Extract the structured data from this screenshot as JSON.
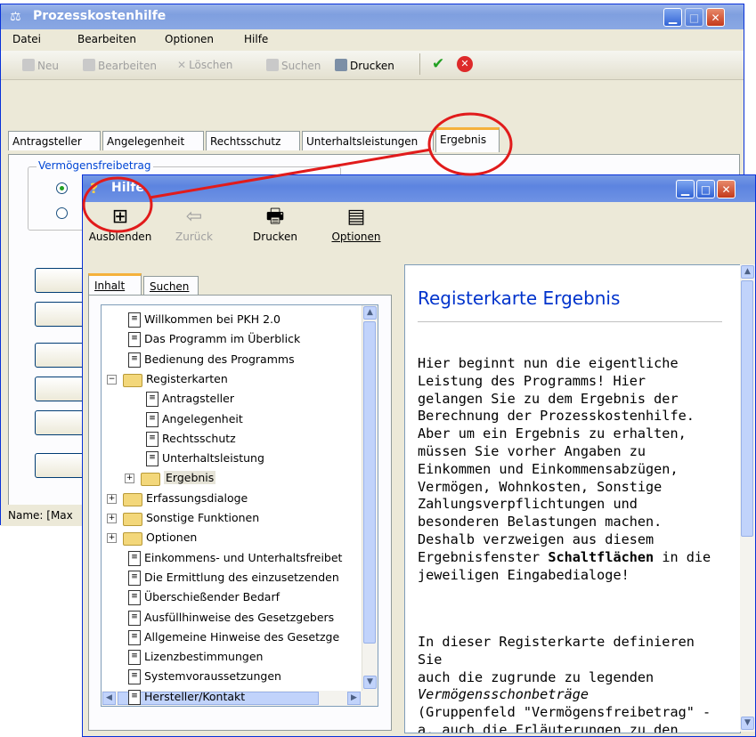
{
  "main_window": {
    "title": "Prozesskostenhilfe",
    "menu": [
      "Datei",
      "Bearbeiten",
      "Optionen",
      "Hilfe"
    ],
    "toolbar": {
      "new_label": "Neu",
      "edit_label": "Bearbeiten",
      "delete_label": "Löschen",
      "search_label": "Suchen",
      "print_label": "Drucken"
    },
    "tabs": [
      "Antragsteller",
      "Angelegenheit",
      "Rechtsschutz",
      "Unterhaltsleistungen",
      "Ergebnis"
    ],
    "group_label": "Vermögensfreibetrag",
    "status_text": "Name: [Max"
  },
  "help_window": {
    "title": "Hilfe",
    "toolbar": {
      "hide_label": "Ausblenden",
      "back_label": "Zurück",
      "print_label": "Drucken",
      "options_label": "Optionen"
    },
    "nav_tabs": [
      "Inhalt",
      "Suchen"
    ],
    "tree": [
      {
        "label": "Willkommen bei PKH 2.0",
        "icon": "page-icon",
        "level": 1
      },
      {
        "label": "Das Programm im Überblick",
        "icon": "page-icon",
        "level": 1
      },
      {
        "label": "Bedienung des Programms",
        "icon": "page-icon",
        "level": 1
      },
      {
        "label": "Registerkarten",
        "icon": "open-folder-icon",
        "level": 0,
        "expanded": true
      },
      {
        "label": "Antragsteller",
        "icon": "page-icon",
        "level": 2
      },
      {
        "label": "Angelegenheit",
        "icon": "page-icon",
        "level": 2
      },
      {
        "label": "Rechtsschutz",
        "icon": "page-icon",
        "level": 2
      },
      {
        "label": "Unterhaltsleistung",
        "icon": "page-icon",
        "level": 2
      },
      {
        "label": "Ergebnis",
        "icon": "folder-icon",
        "level": 1,
        "collapsed": true
      },
      {
        "label": "Erfassungsdialoge",
        "icon": "folder-icon",
        "level": 0,
        "collapsed": true
      },
      {
        "label": "Sonstige Funktionen",
        "icon": "folder-icon",
        "level": 0,
        "collapsed": true
      },
      {
        "label": "Optionen",
        "icon": "folder-icon",
        "level": 0,
        "collapsed": true
      },
      {
        "label": "Einkommens- und Unterhaltsfreibet",
        "icon": "page-icon",
        "level": 1
      },
      {
        "label": "Die Ermittlung des einzusetzenden",
        "icon": "page-icon",
        "level": 1
      },
      {
        "label": "Überschießender Bedarf",
        "icon": "page-icon",
        "level": 1
      },
      {
        "label": "Ausfüllhinweise des Gesetzgebers",
        "icon": "page-icon",
        "level": 1
      },
      {
        "label": "Allgemeine Hinweise des Gesetzge",
        "icon": "page-icon",
        "level": 1
      },
      {
        "label": "Lizenzbestimmungen",
        "icon": "page-icon",
        "level": 1
      },
      {
        "label": "Systemvoraussetzungen",
        "icon": "page-icon",
        "level": 1
      },
      {
        "label": "Hersteller/Kontakt",
        "icon": "page-icon",
        "level": 1
      }
    ],
    "content": {
      "heading": "Registerkarte Ergebnis",
      "para1_lines": [
        "Hier beginnt nun die eigentliche",
        "Leistung des Programms! Hier",
        "gelangen Sie zu dem Ergebnis der",
        "Berechnung der Prozesskostenhilfe.",
        "Aber um ein Ergebnis zu erhalten,",
        "müssen Sie vorher Angaben zu",
        "Einkommen und Einkommensabzügen,",
        "Vermögen, Wohnkosten, Sonstige",
        "Zahlungsverpflichtungen und",
        "besonderen Belastungen machen.",
        "Deshalb verzweigen aus diesem"
      ],
      "para1_tail_before": "Ergebnisfenster ",
      "para1_bold": "Schaltflächen",
      "para1_tail_after": " in die",
      "para1_last": "jeweiligen Eingabedialoge!",
      "para2_lines": [
        "In dieser Registerkarte definieren Sie",
        "auch die zugrunde zu legenden"
      ],
      "para2_italic": "Vermögensschonbeträge",
      "para2_more": [
        "(Gruppenfeld \"Vermögensfreibetrag\" -",
        "a. auch die Erläuterungen zu den"
      ]
    }
  },
  "colors": {
    "titlebar": "#7f9fdf",
    "accent_red": "#e11b1b",
    "link_blue": "#0033cc"
  }
}
